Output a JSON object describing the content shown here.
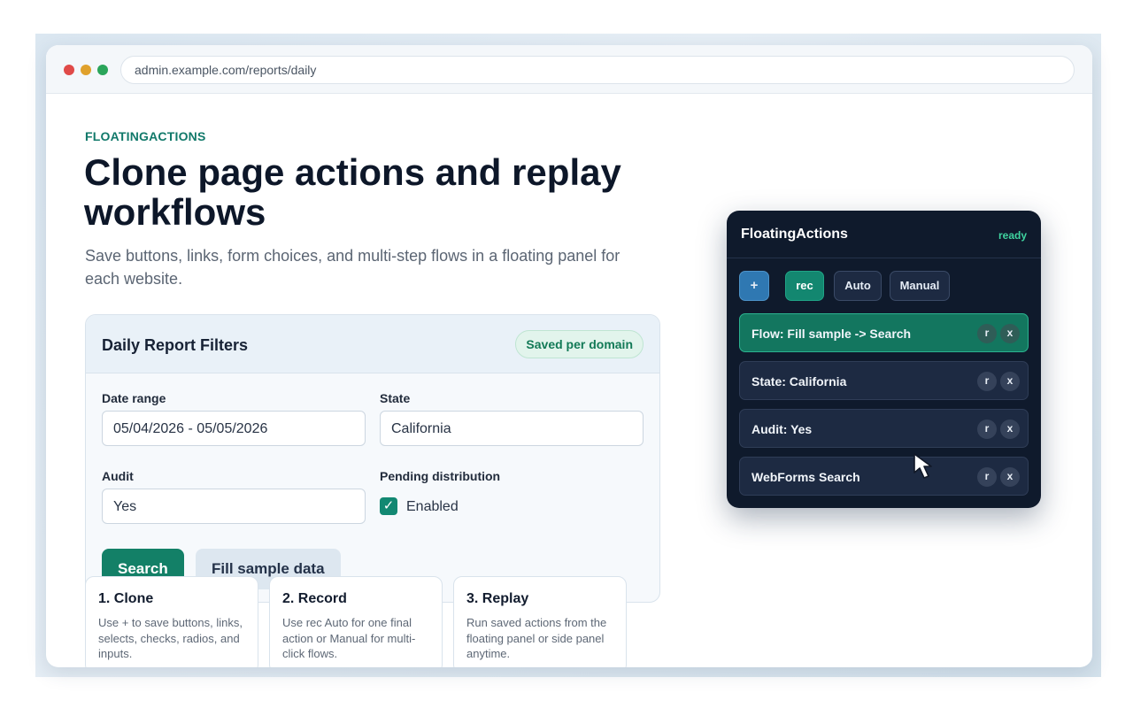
{
  "browser": {
    "url": "admin.example.com/reports/daily"
  },
  "hero": {
    "eyebrow": "FLOATINGACTIONS",
    "title": "Clone page actions and replay workflows",
    "subtitle": "Save buttons, links, form choices, and multi-step flows in a floating panel for each website."
  },
  "filters_card": {
    "title": "Daily Report Filters",
    "badge": "Saved per domain",
    "date_range_label": "Date range",
    "date_range_value": "05/04/2026 - 05/05/2026",
    "state_label": "State",
    "state_value": "California",
    "audit_label": "Audit",
    "audit_value": "Yes",
    "pending_label": "Pending distribution",
    "pending_checked": true,
    "pending_check_label": "Enabled",
    "search_button": "Search",
    "fill_button": "Fill sample data"
  },
  "steps": [
    {
      "title": "1. Clone",
      "description": "Use + to save buttons, links, selects, checks, radios, and inputs."
    },
    {
      "title": "2. Record",
      "description": "Use rec Auto for one final action or Manual for multi-click flows."
    },
    {
      "title": "3. Replay",
      "description": "Run saved actions from the floating panel or side panel anytime."
    }
  ],
  "panel": {
    "title": "FloatingActions",
    "status": "ready",
    "buttons": {
      "add": "+",
      "rec": "rec",
      "auto": "Auto",
      "manual": "Manual"
    },
    "items": [
      {
        "label": "Flow: Fill sample -> Search",
        "active": true,
        "replay": "r",
        "remove": "x"
      },
      {
        "label": "State: California",
        "active": false,
        "replay": "r",
        "remove": "x"
      },
      {
        "label": "Audit: Yes",
        "active": false,
        "replay": "r",
        "remove": "x"
      },
      {
        "label": "WebForms Search",
        "active": false,
        "replay": "r",
        "remove": "x"
      }
    ]
  },
  "colors": {
    "accent": "#138067",
    "panel_bg": "#0f1a2c",
    "status": "#3fd4a0"
  },
  "icons": {
    "checkbox": "check-icon",
    "pointer": "mouse-cursor-icon"
  }
}
